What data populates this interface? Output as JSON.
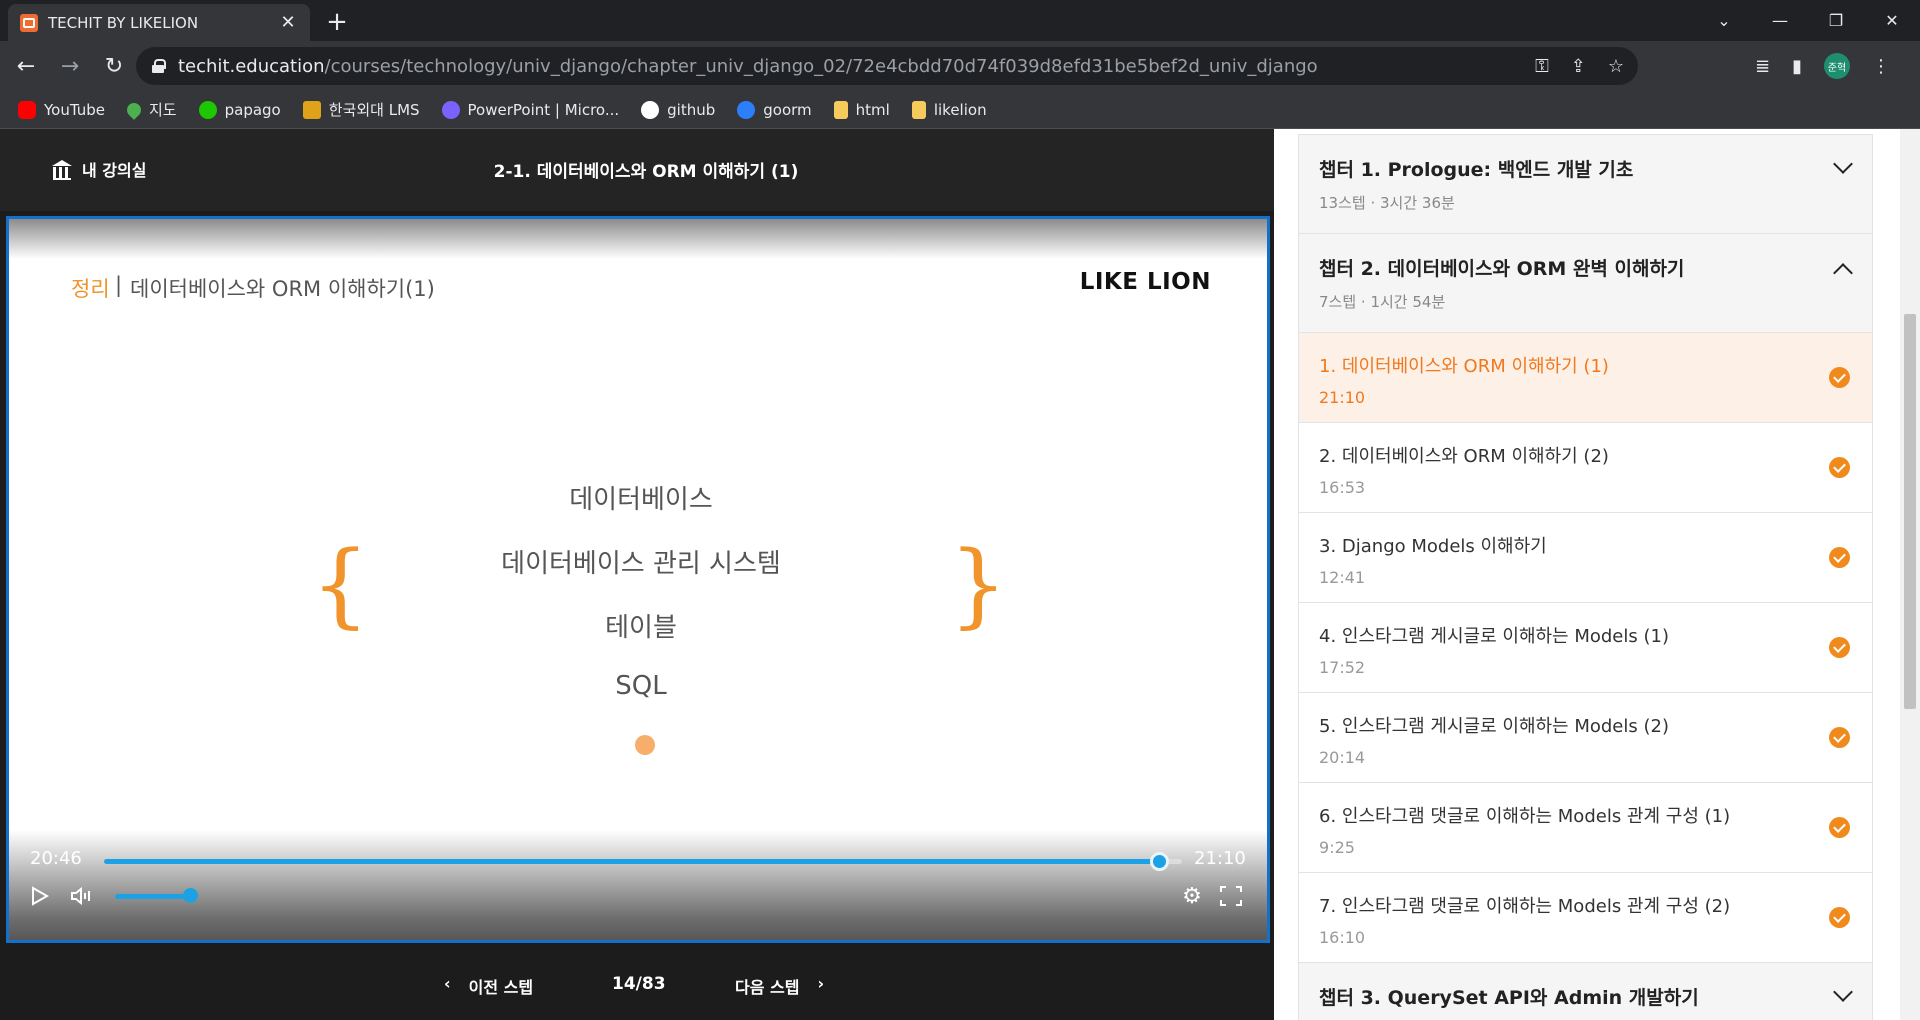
{
  "browser": {
    "tab_title": "TECHIT BY LIKELION",
    "url_host": "techit.education",
    "url_path": "/courses/technology/univ_django/chapter_univ_django_02/72e4cbdd70d74f039d8efd31be5bef2d_univ_django",
    "profile_initials": "준혁",
    "bookmarks": [
      {
        "label": "YouTube",
        "icon": "youtube-icon",
        "color": "#ff0000"
      },
      {
        "label": "지도",
        "icon": "maps-pin-icon",
        "color": "#4caf50"
      },
      {
        "label": "papago",
        "icon": "papago-icon",
        "color": "#1ec800"
      },
      {
        "label": "한국외대 LMS",
        "icon": "hand-icon",
        "color": "#e0a21b"
      },
      {
        "label": "PowerPoint | Micro...",
        "icon": "copilot-icon",
        "color": "#7b61ff"
      },
      {
        "label": "github",
        "icon": "github-icon",
        "color": "#ffffff"
      },
      {
        "label": "goorm",
        "icon": "goorm-icon",
        "color": "#2d7ff9"
      },
      {
        "label": "html",
        "icon": "folder-icon",
        "color": "#f5cb5c"
      },
      {
        "label": "likelion",
        "icon": "folder-icon",
        "color": "#f5cb5c"
      }
    ]
  },
  "header": {
    "home_label": "내 강의실",
    "lesson_title": "2-1. 데이터베이스와 ORM 이해하기 (1)"
  },
  "slide": {
    "category": "정리",
    "separator": "|",
    "subtitle": "데이터베이스와 ORM 이해하기(1)",
    "brand": "LIKE LION",
    "items": [
      "데이터베이스",
      "데이터베이스 관리 시스템",
      "테이블",
      "SQL"
    ]
  },
  "player": {
    "current_time": "20:46",
    "duration": "21:10",
    "progress_fraction": 0.98,
    "volume_fraction": 1.0,
    "accent_color": "#1da1e5"
  },
  "step_nav": {
    "prev_label": "이전 스텝",
    "count": "14/83",
    "next_label": "다음 스텝"
  },
  "curriculum": {
    "chapter1": {
      "title": "챕터 1. Prologue: 백엔드 개발 기초",
      "meta": "13스텝 · 3시간 36분"
    },
    "chapter2": {
      "title": "챕터 2. 데이터베이스와 ORM 완벽 이해하기",
      "meta": "7스텝 · 1시간 54분"
    },
    "steps": [
      {
        "title": "1. 데이터베이스와 ORM 이해하기 (1)",
        "time": "21:10"
      },
      {
        "title": "2. 데이터베이스와 ORM 이해하기 (2)",
        "time": "16:53"
      },
      {
        "title": "3. Django Models 이해하기",
        "time": "12:41"
      },
      {
        "title": "4. 인스타그램 게시글로 이해하는 Models (1)",
        "time": "17:52"
      },
      {
        "title": "5. 인스타그램 게시글로 이해하는 Models (2)",
        "time": "20:14"
      },
      {
        "title": "6. 인스타그램 댓글로 이해하는 Models 관계 구성 (1)",
        "time": "9:25"
      },
      {
        "title": "7. 인스타그램 댓글로 이해하는 Models 관계 구성 (2)",
        "time": "16:10"
      }
    ],
    "chapter3": {
      "title": "챕터 3. QuerySet API와 Admin 개발하기"
    },
    "accent_color": "#f08a1c"
  }
}
